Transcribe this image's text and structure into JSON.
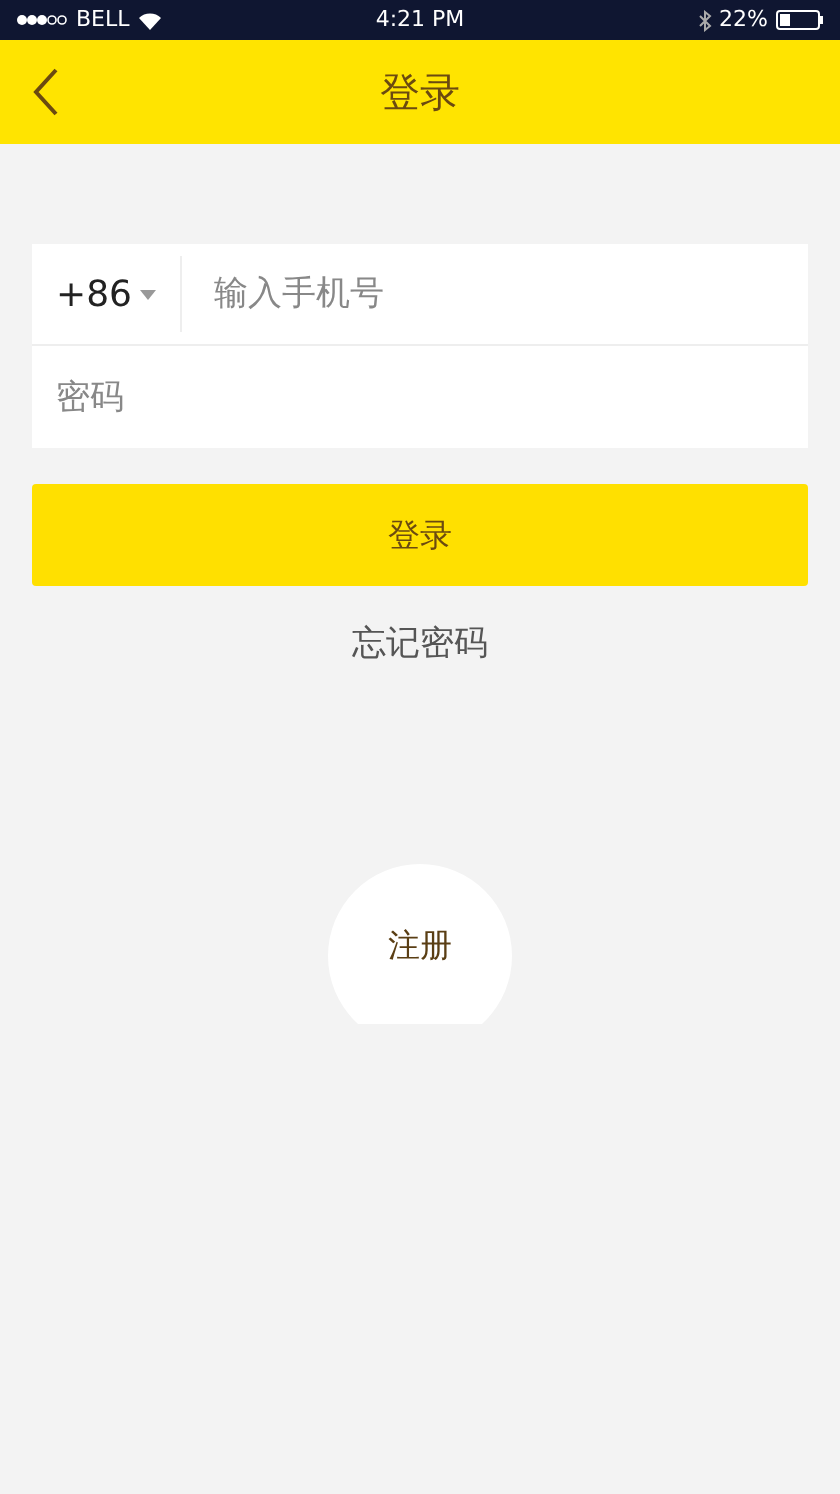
{
  "status_bar": {
    "carrier": "BELL",
    "time": "4:21 PM",
    "battery": "22%"
  },
  "header": {
    "title": "登录"
  },
  "form": {
    "country_code": "+86",
    "phone": {
      "placeholder": "输入手机号"
    },
    "password": {
      "placeholder": "密码"
    }
  },
  "login_button": "登录",
  "forgot_link": "忘记密码",
  "register_button": "注册"
}
